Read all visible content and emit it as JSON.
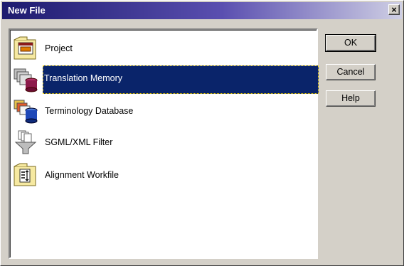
{
  "window": {
    "title": "New File",
    "close_glyph": "×"
  },
  "list": {
    "items": [
      {
        "label": "Project",
        "icon": "project-folder-icon",
        "selected": false
      },
      {
        "label": "Translation Memory",
        "icon": "translation-memory-icon",
        "selected": true
      },
      {
        "label": "Terminology Database",
        "icon": "terminology-database-icon",
        "selected": false
      },
      {
        "label": "SGML/XML Filter",
        "icon": "sgml-xml-filter-icon",
        "selected": false
      },
      {
        "label": "Alignment Workfile",
        "icon": "alignment-workfile-icon",
        "selected": false
      }
    ]
  },
  "buttons": {
    "ok": "OK",
    "cancel": "Cancel",
    "help": "Help"
  },
  "colors": {
    "title_gradient_start": "#1d1b6e",
    "selection": "#0a246a",
    "face": "#d4d0c8"
  }
}
